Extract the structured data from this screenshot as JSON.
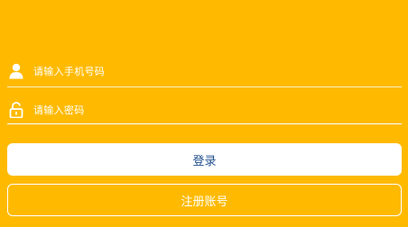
{
  "colors": {
    "background": "#FFBA00",
    "login_text": "#1F4E8C",
    "white": "#FFFFFF"
  },
  "phone_field": {
    "icon": "user-icon",
    "placeholder": "请输入手机号码"
  },
  "password_field": {
    "icon": "unlock-icon",
    "placeholder": "请输入密码"
  },
  "buttons": {
    "login_label": "登录",
    "register_label": "注册账号"
  }
}
